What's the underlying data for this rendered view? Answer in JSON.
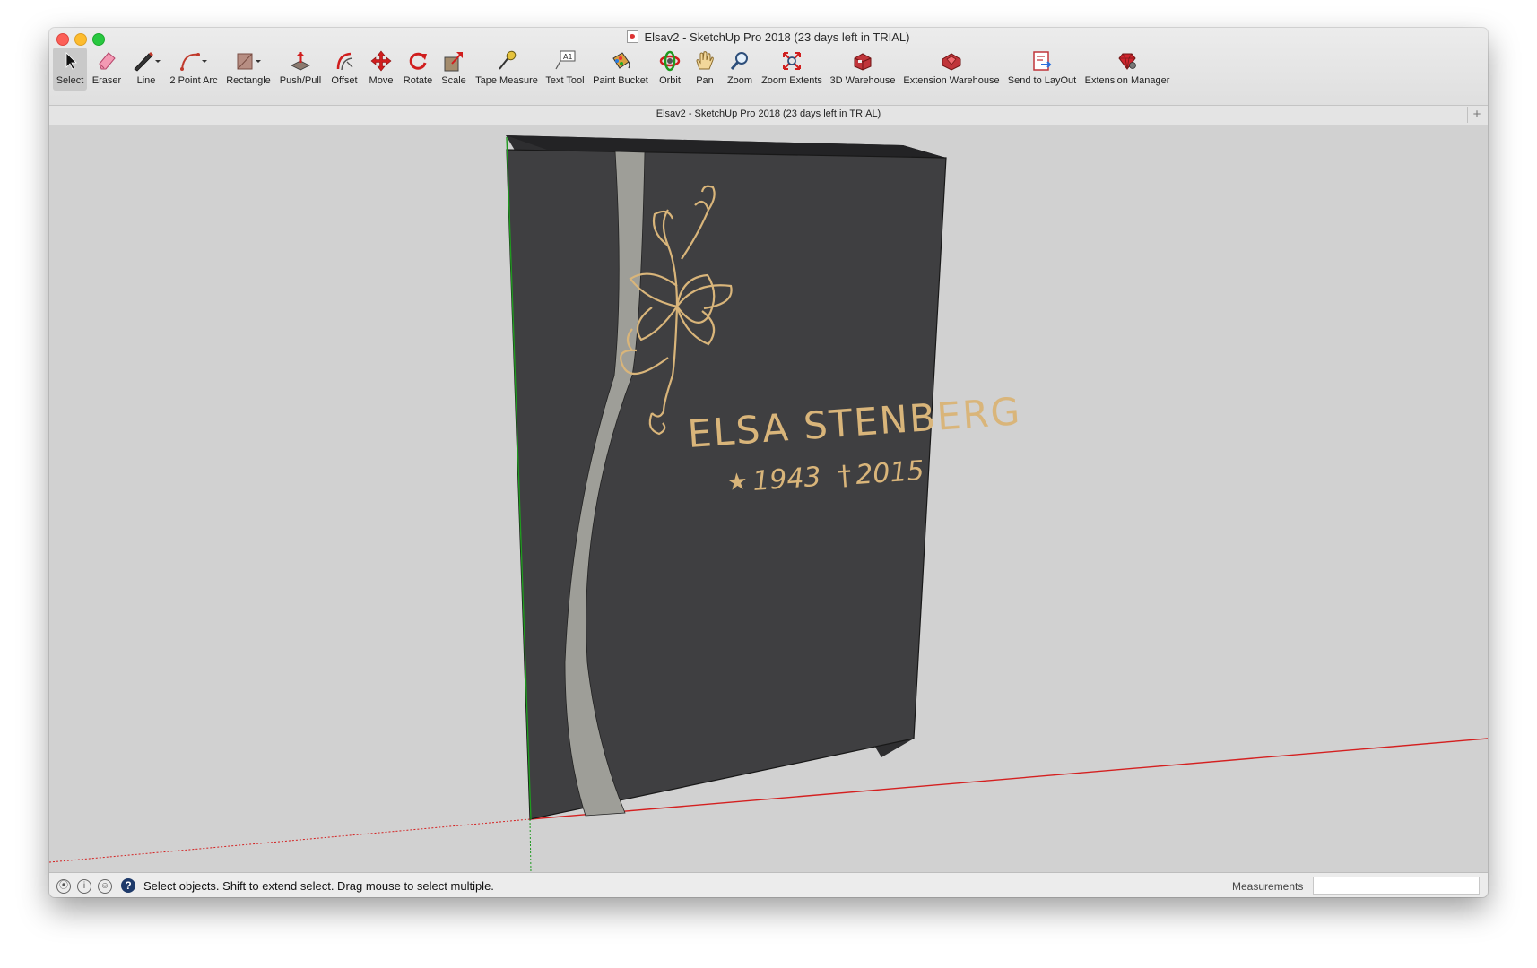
{
  "window": {
    "title": "Elsav2 - SketchUp Pro 2018 (23 days left in TRIAL)"
  },
  "toolbar": {
    "tools": [
      {
        "label": "Select",
        "icon": "arrow-cursor-icon",
        "active": true
      },
      {
        "label": "Eraser",
        "icon": "eraser-icon"
      },
      {
        "label": "Line",
        "icon": "pencil-icon",
        "dropdown": true
      },
      {
        "label": "2 Point Arc",
        "icon": "arc-icon",
        "dropdown": true
      },
      {
        "label": "Rectangle",
        "icon": "rectangle-icon",
        "dropdown": true
      },
      {
        "label": "Push/Pull",
        "icon": "push-pull-icon"
      },
      {
        "label": "Offset",
        "icon": "offset-icon"
      },
      {
        "label": "Move",
        "icon": "move-arrows-icon"
      },
      {
        "label": "Rotate",
        "icon": "rotate-icon"
      },
      {
        "label": "Scale",
        "icon": "scale-icon"
      },
      {
        "label": "Tape Measure",
        "icon": "tape-measure-icon"
      },
      {
        "label": "Text Tool",
        "icon": "text-tool-icon"
      },
      {
        "label": "Paint Bucket",
        "icon": "paint-bucket-icon"
      },
      {
        "label": "Orbit",
        "icon": "orbit-icon"
      },
      {
        "label": "Pan",
        "icon": "hand-icon"
      },
      {
        "label": "Zoom",
        "icon": "magnifier-icon"
      },
      {
        "label": "Zoom Extents",
        "icon": "zoom-extents-icon"
      },
      {
        "label": "3D Warehouse",
        "icon": "warehouse-icon"
      },
      {
        "label": "Extension Warehouse",
        "icon": "extension-warehouse-icon"
      },
      {
        "label": "Send to LayOut",
        "icon": "send-to-layout-icon"
      },
      {
        "label": "Extension Manager",
        "icon": "ruby-gem-icon"
      }
    ]
  },
  "document_tab": {
    "title": "Elsav2 - SketchUp Pro 2018 (23 days left in TRIAL)",
    "add_icon": "plus-icon"
  },
  "model": {
    "name_line": "ELSA STENBERG",
    "birth_year": "1943",
    "death_year": "2015",
    "birth_symbol": "★",
    "death_symbol": "†"
  },
  "statusbar": {
    "message": "Select objects. Shift to extend select. Drag mouse to select multiple.",
    "measurements_label": "Measurements",
    "measurements_value": "",
    "help_symbol": "?"
  },
  "colors": {
    "stone": "#3f3f41",
    "stripe": "#9e9e98",
    "gold": "#d9b57a",
    "axis_red": "#d42020",
    "axis_green": "#1f9a1f",
    "viewport_bg": "#d1d1d1"
  }
}
